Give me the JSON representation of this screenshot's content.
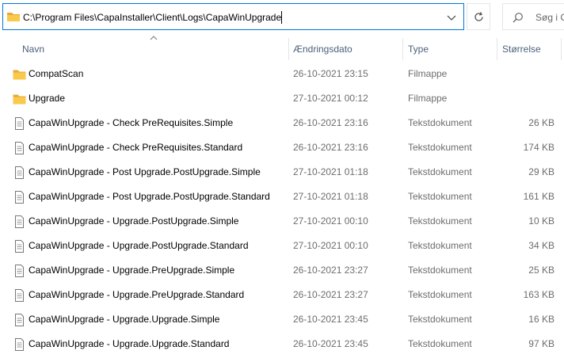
{
  "address_bar": {
    "path": "C:\\Program Files\\CapaInstaller\\Client\\Logs\\CapaWinUpgrade"
  },
  "search": {
    "placeholder": "Søg i C"
  },
  "columns": {
    "name": "Navn",
    "date": "Ændringsdato",
    "type": "Type",
    "size": "Størrelse"
  },
  "files": [
    {
      "name": "CompatScan",
      "date": "26-10-2021 23:15",
      "type": "Filmappe",
      "size": "",
      "icon": "folder-icon"
    },
    {
      "name": "Upgrade",
      "date": "27-10-2021 00:12",
      "type": "Filmappe",
      "size": "",
      "icon": "folder-icon"
    },
    {
      "name": "CapaWinUpgrade - Check PreRequisites.Simple",
      "date": "26-10-2021 23:16",
      "type": "Tekstdokument",
      "size": "26 KB",
      "icon": "text-file-icon"
    },
    {
      "name": "CapaWinUpgrade - Check PreRequisites.Standard",
      "date": "26-10-2021 23:16",
      "type": "Tekstdokument",
      "size": "174 KB",
      "icon": "text-file-icon"
    },
    {
      "name": "CapaWinUpgrade - Post Upgrade.PostUpgrade.Simple",
      "date": "27-10-2021 01:18",
      "type": "Tekstdokument",
      "size": "29 KB",
      "icon": "text-file-icon"
    },
    {
      "name": "CapaWinUpgrade - Post Upgrade.PostUpgrade.Standard",
      "date": "27-10-2021 01:18",
      "type": "Tekstdokument",
      "size": "161 KB",
      "icon": "text-file-icon"
    },
    {
      "name": "CapaWinUpgrade - Upgrade.PostUpgrade.Simple",
      "date": "27-10-2021 00:10",
      "type": "Tekstdokument",
      "size": "10 KB",
      "icon": "text-file-icon"
    },
    {
      "name": "CapaWinUpgrade - Upgrade.PostUpgrade.Standard",
      "date": "27-10-2021 00:10",
      "type": "Tekstdokument",
      "size": "34 KB",
      "icon": "text-file-icon"
    },
    {
      "name": "CapaWinUpgrade - Upgrade.PreUpgrade.Simple",
      "date": "26-10-2021 23:27",
      "type": "Tekstdokument",
      "size": "25 KB",
      "icon": "text-file-icon"
    },
    {
      "name": "CapaWinUpgrade - Upgrade.PreUpgrade.Standard",
      "date": "26-10-2021 23:27",
      "type": "Tekstdokument",
      "size": "163 KB",
      "icon": "text-file-icon"
    },
    {
      "name": "CapaWinUpgrade - Upgrade.Upgrade.Simple",
      "date": "26-10-2021 23:45",
      "type": "Tekstdokument",
      "size": "16 KB",
      "icon": "text-file-icon"
    },
    {
      "name": "CapaWinUpgrade - Upgrade.Upgrade.Standard",
      "date": "26-10-2021 23:45",
      "type": "Tekstdokument",
      "size": "97 KB",
      "icon": "text-file-icon"
    }
  ],
  "colors": {
    "accent": "#0078d4",
    "folder": "#f8c94a",
    "header_text": "#4c607a",
    "secondary_text": "#6d6d6d"
  }
}
